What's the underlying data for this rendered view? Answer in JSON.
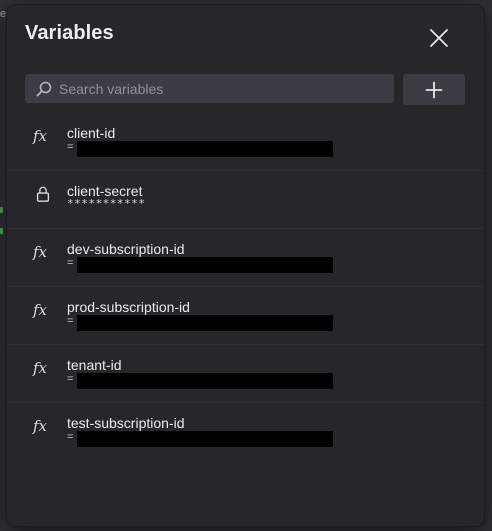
{
  "background": {
    "edge_text": "e"
  },
  "dialog": {
    "title": "Variables",
    "close_icon": "close-icon",
    "search": {
      "placeholder": "Search variables",
      "value": ""
    },
    "add_icon": "plus-icon"
  },
  "variables": [
    {
      "name": "client-id",
      "type": "fx",
      "value_prefix": "=",
      "secret": false
    },
    {
      "name": "client-secret",
      "type": "lock",
      "masked_value": "***********",
      "secret": true
    },
    {
      "name": "dev-subscription-id",
      "type": "fx",
      "value_prefix": "=",
      "secret": false
    },
    {
      "name": "prod-subscription-id",
      "type": "fx",
      "value_prefix": "=",
      "secret": false
    },
    {
      "name": "tenant-id",
      "type": "fx",
      "value_prefix": "=",
      "secret": false
    },
    {
      "name": "test-subscription-id",
      "type": "fx",
      "value_prefix": "=",
      "secret": false
    }
  ],
  "colors": {
    "panel_bg": "#25272b",
    "input_bg": "#3a3d43",
    "text_primary": "#e9ebee",
    "text_muted": "#8d9299",
    "redaction": "#000000"
  }
}
